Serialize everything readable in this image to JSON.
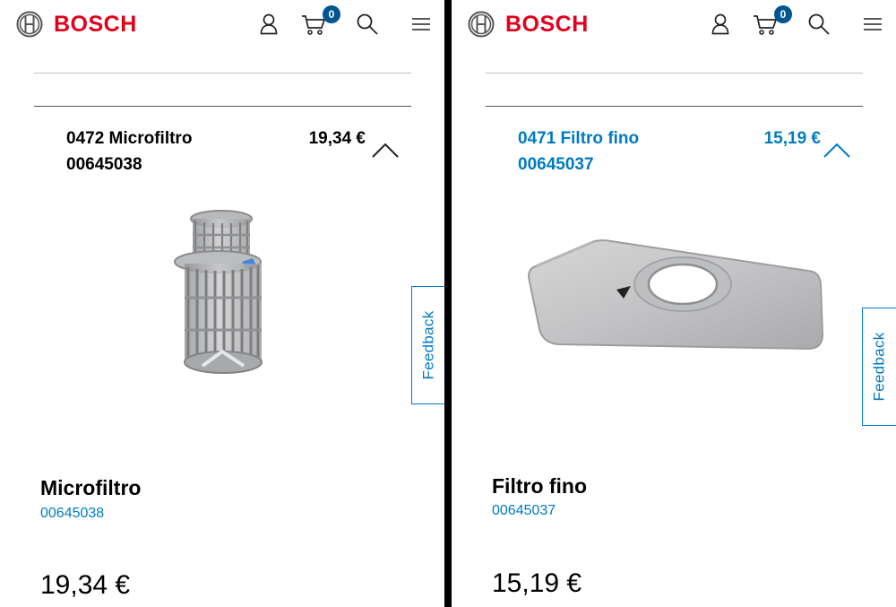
{
  "brand": {
    "name": "BOSCH",
    "color": "#e2001a",
    "accent": "#007bc0",
    "badge_color": "#005691"
  },
  "icons": [
    "bosch-logo-icon",
    "user-icon",
    "cart-icon",
    "search-icon",
    "menu-icon",
    "chevron-up-icon"
  ],
  "panels": [
    {
      "header": {
        "cart_count": "0"
      },
      "accordion": {
        "title": "0472 Microfiltro",
        "number": "00645038",
        "price": "19,34 €",
        "expanded": true
      },
      "feedback": "Feedback",
      "product": {
        "name": "Microfiltro",
        "sku": "00645038",
        "price": "19,34 €",
        "image": "cylindrical grey mesh microfilter"
      }
    },
    {
      "header": {
        "cart_count": "0"
      },
      "accordion": {
        "title": "0471 Filtro fino",
        "number": "00645037",
        "price": "15,19 €",
        "expanded": true
      },
      "feedback": "Feedback",
      "product": {
        "name": "Filtro fino",
        "sku": "00645037",
        "price": "15,19 €",
        "image": "flat grey mesh fine filter plate"
      }
    }
  ]
}
